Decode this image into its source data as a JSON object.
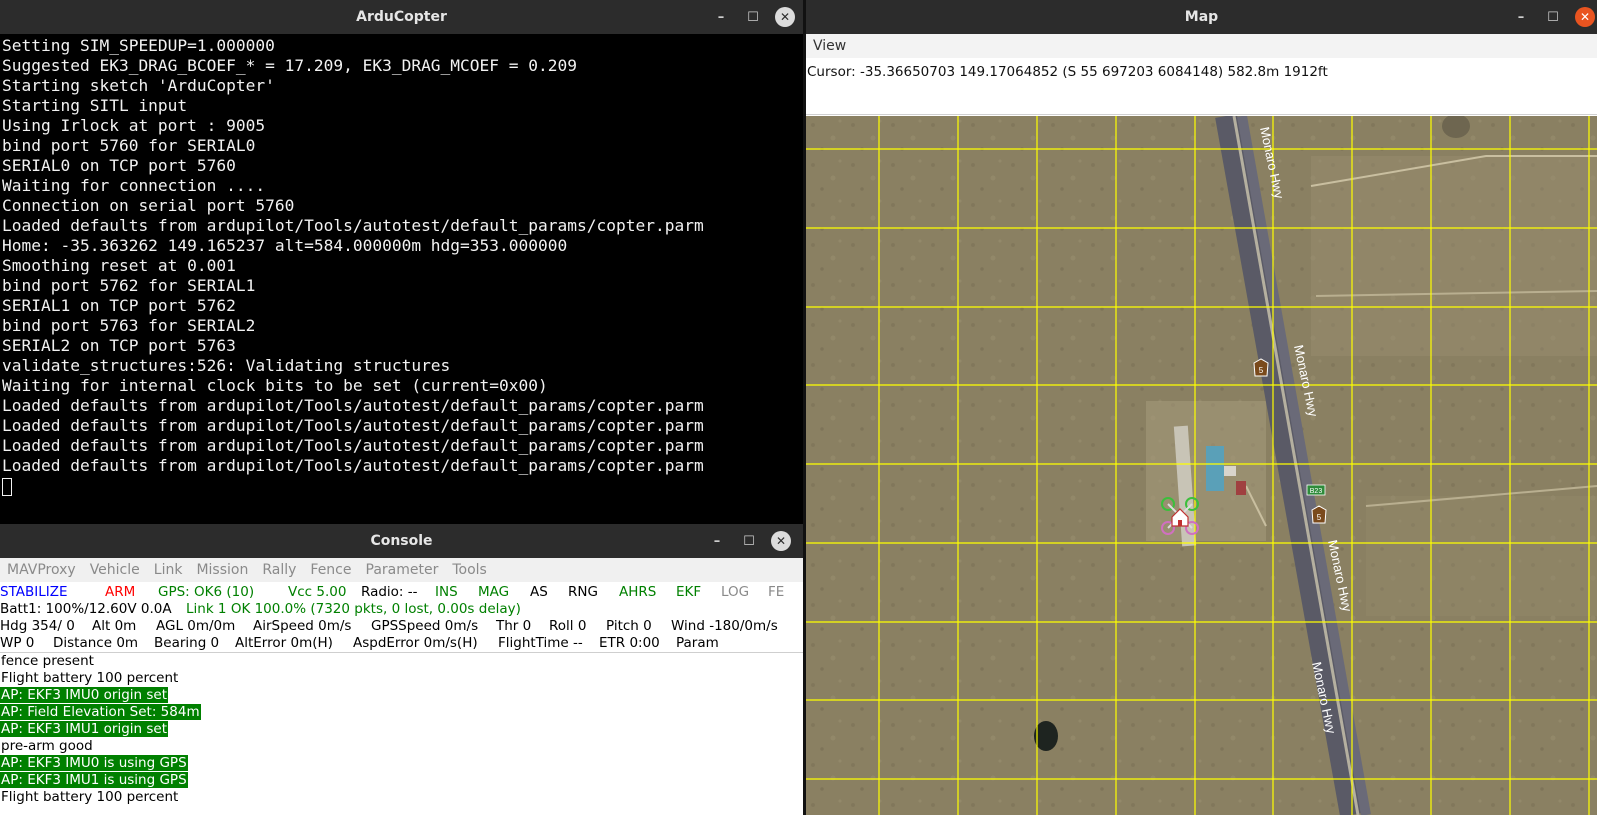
{
  "ardu_window": {
    "title": "ArduCopter",
    "lines": [
      "Setting SIM_SPEEDUP=1.000000",
      "Suggested EK3_DRAG_BCOEF_* = 17.209, EK3_DRAG_MCOEF = 0.209",
      "Starting sketch 'ArduCopter'",
      "Starting SITL input",
      "Using Irlock at port : 9005",
      "bind port 5760 for SERIAL0",
      "SERIAL0 on TCP port 5760",
      "Waiting for connection ....",
      "Connection on serial port 5760",
      "Loaded defaults from ardupilot/Tools/autotest/default_params/copter.parm",
      "Home: -35.363262 149.165237 alt=584.000000m hdg=353.000000",
      "Smoothing reset at 0.001",
      "bind port 5762 for SERIAL1",
      "SERIAL1 on TCP port 5762",
      "bind port 5763 for SERIAL2",
      "SERIAL2 on TCP port 5763",
      "validate_structures:526: Validating structures",
      "Waiting for internal clock bits to be set (current=0x00)",
      "Loaded defaults from ardupilot/Tools/autotest/default_params/copter.parm",
      "Loaded defaults from ardupilot/Tools/autotest/default_params/copter.parm",
      "Loaded defaults from ardupilot/Tools/autotest/default_params/copter.parm",
      "Loaded defaults from ardupilot/Tools/autotest/default_params/copter.parm"
    ]
  },
  "console_window": {
    "title": "Console",
    "menu": [
      "MAVProxy",
      "Vehicle",
      "Link",
      "Mission",
      "Rally",
      "Fence",
      "Parameter",
      "Tools"
    ],
    "row1": [
      {
        "text": "STABILIZE",
        "color": "#0000ff"
      },
      {
        "text": "ARM",
        "color": "#ff0000"
      },
      {
        "text": "GPS: OK6 (10)",
        "color": "#008000"
      },
      {
        "text": "Vcc 5.00",
        "color": "#008000"
      },
      {
        "text": "Radio: --",
        "color": "#000000"
      },
      {
        "text": "INS",
        "color": "#008000"
      },
      {
        "text": "MAG",
        "color": "#008000"
      },
      {
        "text": "AS",
        "color": "#000000"
      },
      {
        "text": "RNG",
        "color": "#000000"
      },
      {
        "text": "AHRS",
        "color": "#008000"
      },
      {
        "text": "EKF",
        "color": "#008000"
      },
      {
        "text": "LOG",
        "color": "#8a8a8a"
      },
      {
        "text": "FE",
        "color": "#8a8a8a"
      }
    ],
    "row2": [
      {
        "text": "Batt1: 100%/12.60V 0.0A",
        "color": "#000000"
      },
      {
        "text": "Link 1 OK 100.0% (7320 pkts, 0 lost, 0.00s delay)",
        "color": "#008000"
      }
    ],
    "row3": [
      {
        "text": "Hdg 354/ 0",
        "color": "#000000"
      },
      {
        "text": "Alt 0m",
        "color": "#000000"
      },
      {
        "text": "AGL 0m/0m",
        "color": "#000000"
      },
      {
        "text": "AirSpeed 0m/s",
        "color": "#000000"
      },
      {
        "text": "GPSSpeed 0m/s",
        "color": "#000000"
      },
      {
        "text": "Thr 0",
        "color": "#000000"
      },
      {
        "text": "Roll 0",
        "color": "#000000"
      },
      {
        "text": "Pitch 0",
        "color": "#000000"
      },
      {
        "text": "Wind -180/0m/s",
        "color": "#000000"
      }
    ],
    "row4": [
      {
        "text": "WP 0",
        "color": "#000000"
      },
      {
        "text": "Distance 0m",
        "color": "#000000"
      },
      {
        "text": "Bearing 0",
        "color": "#000000"
      },
      {
        "text": "AltError 0m(H)",
        "color": "#000000"
      },
      {
        "text": "AspdError 0m/s(H)",
        "color": "#000000"
      },
      {
        "text": "FlightTime --",
        "color": "#000000"
      },
      {
        "text": "ETR 0:00",
        "color": "#000000"
      },
      {
        "text": "Param",
        "color": "#000000"
      }
    ],
    "messages": [
      {
        "text": "fence present",
        "highlight": false
      },
      {
        "text": "Flight battery 100 percent",
        "highlight": false
      },
      {
        "text": "AP: EKF3 IMU0 origin set",
        "highlight": true
      },
      {
        "text": "AP: Field Elevation Set: 584m",
        "highlight": true
      },
      {
        "text": "AP: EKF3 IMU1 origin set",
        "highlight": true
      },
      {
        "text": "pre-arm good",
        "highlight": false
      },
      {
        "text": "AP: EKF3 IMU0 is using GPS",
        "highlight": true
      },
      {
        "text": "AP: EKF3 IMU1 is using GPS",
        "highlight": true
      },
      {
        "text": "Flight battery 100 percent",
        "highlight": false
      }
    ]
  },
  "map_window": {
    "title": "Map",
    "view_menu": "View",
    "cursor_text": "Cursor: -35.36650703 149.17064852 (S 55 697203 6084148) 582.8m 1912ft",
    "road_labels": [
      "Monaro Hwy",
      "Monaro Hwy",
      "Monaro Hwy",
      "Monaro Hwy"
    ],
    "route_shield": "5",
    "route_shield_green": "B23",
    "grid_color": "#ffff00"
  },
  "window_controls": {
    "minimize": "–",
    "maximize": "☐",
    "close": "✕"
  }
}
